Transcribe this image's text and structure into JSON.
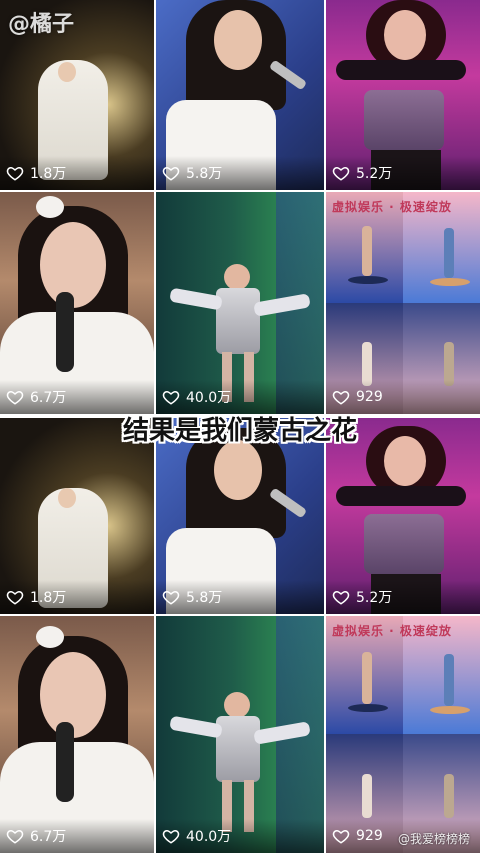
{
  "watermark_top": "@橘子",
  "caption": "结果是我们蒙古之花",
  "watermark_bottom": "@我爱榜榜榜",
  "poster_title": "虚拟娱乐 · 极速绽放",
  "rows": [
    {
      "tiles": [
        {
          "likes": "1.8万",
          "scene": "white-dress-chair"
        },
        {
          "likes": "5.8万",
          "scene": "singer-white-blue"
        },
        {
          "likes": "5.2万",
          "scene": "performer-pink"
        }
      ]
    },
    {
      "tiles": [
        {
          "likes": "6.7万",
          "scene": "closeup-white"
        },
        {
          "likes": "40.0万",
          "scene": "silver-fringe-green"
        },
        {
          "likes": "929",
          "scene": "poster-grid"
        }
      ]
    },
    {
      "tiles": [
        {
          "likes": "1.8万",
          "scene": "white-dress-chair"
        },
        {
          "likes": "5.8万",
          "scene": "singer-white-blue"
        },
        {
          "likes": "5.2万",
          "scene": "performer-pink"
        }
      ]
    },
    {
      "tiles": [
        {
          "likes": "6.7万",
          "scene": "closeup-white"
        },
        {
          "likes": "40.0万",
          "scene": "silver-fringe-green"
        },
        {
          "likes": "929",
          "scene": "poster-grid"
        }
      ]
    }
  ],
  "colors": {
    "like_text": "#ffffff",
    "caption_text": "#111111"
  }
}
